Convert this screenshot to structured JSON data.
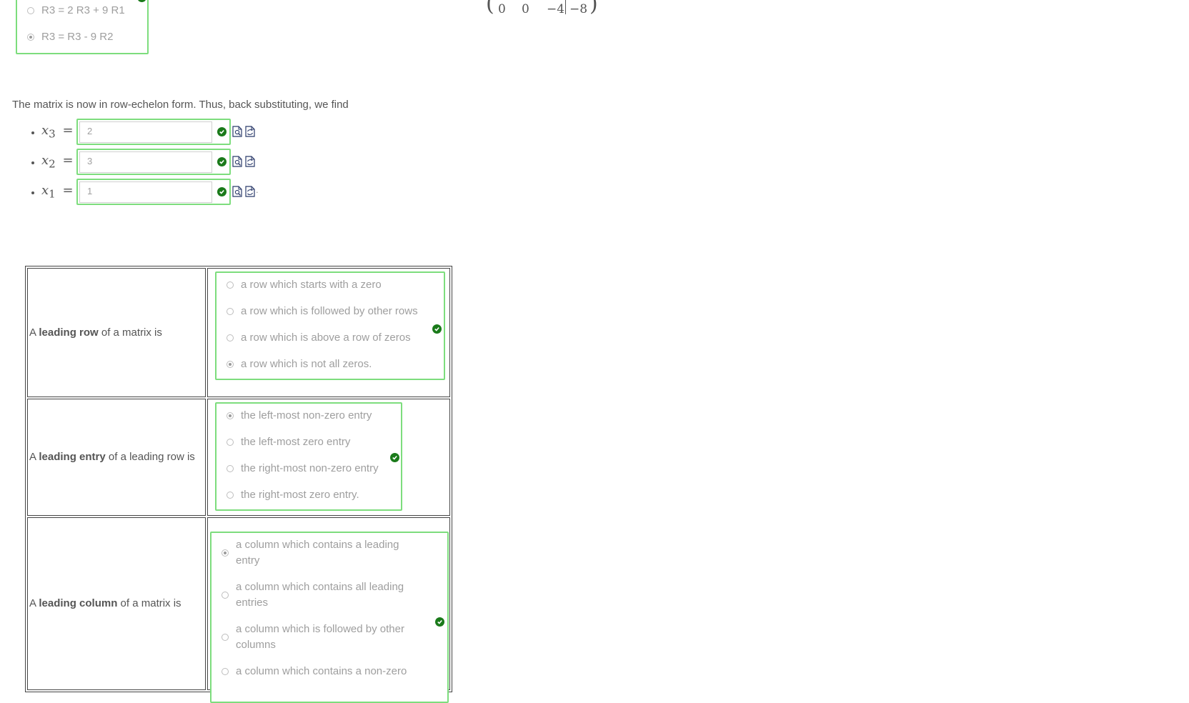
{
  "row_ops": {
    "options": [
      {
        "label": "R3 = 2 R3 + 9 R1",
        "checked": false
      },
      {
        "label": "R3 = R3 - 9 R2",
        "checked": true
      }
    ]
  },
  "matrix_row": {
    "c1": "0",
    "c2": "0",
    "c3": "−4",
    "c4": "−8"
  },
  "intro_text": "The matrix is now in row-echelon form. Thus, back substituting, we find",
  "answers": [
    {
      "var": "x",
      "sub": "3",
      "eq": "=",
      "value": "2"
    },
    {
      "var": "x",
      "sub": "2",
      "eq": "=",
      "value": "3"
    },
    {
      "var": "x",
      "sub": "1",
      "eq": "=",
      "value": "1",
      "trail": "."
    }
  ],
  "questions": [
    {
      "prefix": "A ",
      "term": "leading row",
      "suffix": " of a matrix is",
      "options": [
        {
          "label": "a row which starts with a zero",
          "checked": false
        },
        {
          "label": "a row which is followed by other rows",
          "checked": false
        },
        {
          "label": "a row which is above a row of zeros",
          "checked": false
        },
        {
          "label": "a row which is not all zeros.",
          "checked": true
        }
      ]
    },
    {
      "prefix": "A ",
      "term": "leading entry",
      "suffix": " of a leading row is",
      "options": [
        {
          "label": "the left-most non-zero entry",
          "checked": true
        },
        {
          "label": "the left-most zero entry",
          "checked": false
        },
        {
          "label": "the right-most non-zero entry",
          "checked": false
        },
        {
          "label": "the right-most zero entry.",
          "checked": false
        }
      ]
    },
    {
      "prefix": "A ",
      "term": "leading column",
      "suffix": " of a matrix is",
      "options": [
        {
          "label": "a column which contains a leading entry",
          "checked": true
        },
        {
          "label": "a column which contains all leading entries",
          "checked": false
        },
        {
          "label": "a column which is followed by other columns",
          "checked": false
        },
        {
          "label": "a column which contains a non-zero",
          "checked": false
        }
      ]
    }
  ],
  "colors": {
    "correct": "#1a7a1a",
    "box_border": "#7ddd7d"
  },
  "icons": [
    "check-icon",
    "preview-icon",
    "show-answer-icon"
  ]
}
